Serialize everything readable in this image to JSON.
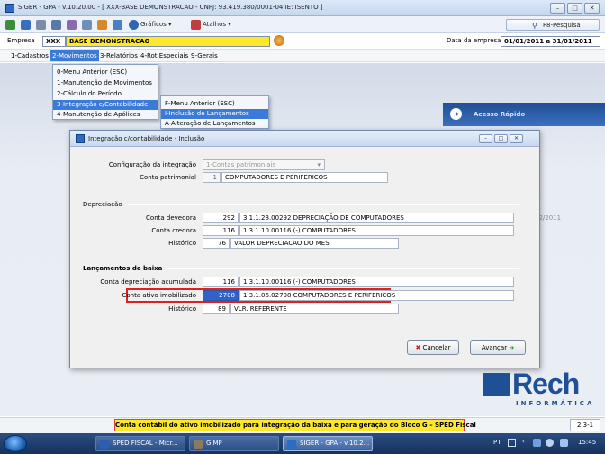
{
  "window": {
    "title": "SIGER - GPA - v.10.20.00 - [ XXX-BASE DEMONSTRACAO - CNPJ: 93.419.380/0001-04 IE: ISENTO ]",
    "controls": [
      "–",
      "□",
      "✕"
    ]
  },
  "toolbar": {
    "graficos": "Gráficos",
    "atalhos": "Atalhos",
    "f8": "F8-Pesquisa"
  },
  "empresa": {
    "label": "Empresa",
    "code": "XXX",
    "name": "BASE DEMONSTRACAO",
    "date_label": "Data da empresa",
    "date_value": "01/01/2011 a 31/01/2011"
  },
  "menubar": [
    "1-Cadastros",
    "2-Movimentos",
    "3-Relatórios",
    "4-Rot.Especiais",
    "9-Gerais"
  ],
  "movimentos_menu": [
    "0-Menu Anterior (ESC)",
    "1-Manutenção de Movimentos",
    "2-Cálculo do Período",
    "3-Integração c/Contabilidade",
    "4-Manutenção de Apólices"
  ],
  "integracao_menu": [
    "F-Menu Anterior (ESC)",
    "I-Inclusão de Lançamentos",
    "A-Alteração de Lançamentos"
  ],
  "acesso_rapido": "Acesso Rápido",
  "background_date": "02/2011",
  "dialog": {
    "title": "Integração c/contabilidade - Inclusão",
    "config_label": "Configuração da integração",
    "config_value": "1-Contas patrimoniais",
    "conta_patrimonial_label": "Conta patrimonial",
    "conta_patrimonial_num": "1",
    "conta_patrimonial_desc": "COMPUTADORES E PERIFERICOS",
    "depreciacao": {
      "title": "Depreciacão",
      "devedora_label": "Conta devedora",
      "devedora_num": "292",
      "devedora_desc": "3.1.1.28.00292 DEPRECIAÇÃO DE COMPUTADORES",
      "credora_label": "Conta credora",
      "credora_num": "116",
      "credora_desc": "1.3.1.10.00116 (-) COMPUTADORES",
      "historico_label": "Histórico",
      "historico_num": "76",
      "historico_desc": "VALOR DEPRECIACAO DO MES"
    },
    "baixa": {
      "title": "Lançamentos de baixa",
      "dep_acum_label": "Conta depreciação acumulada",
      "dep_acum_num": "116",
      "dep_acum_desc": "1.3.1.10.00116 (-) COMPUTADORES",
      "ativo_label": "Conta ativo imobilizado",
      "ativo_num": "2708",
      "ativo_desc": "1.3.1.06.02708 COMPUTADORES E PERIFERICOS",
      "historico_label": "Histórico",
      "historico_num": "89",
      "historico_desc": "VLR. REFERENTE"
    },
    "cancel": "Cancelar",
    "next": "Avançar"
  },
  "logo": {
    "name": "Rech",
    "sub": "INFORMÁTICA"
  },
  "status": {
    "message": "Conta contábil do ativo imobilizado para integração da baixa e para geração do Bloco G – SPED Fiscal",
    "code": "2.3-1"
  },
  "taskbar": {
    "tasks": [
      "SPED FISCAL - Micr...",
      "GIMP",
      "SIGER - GPA - v.10.2..."
    ],
    "tray_lang": "PT",
    "clock": "15:45"
  }
}
